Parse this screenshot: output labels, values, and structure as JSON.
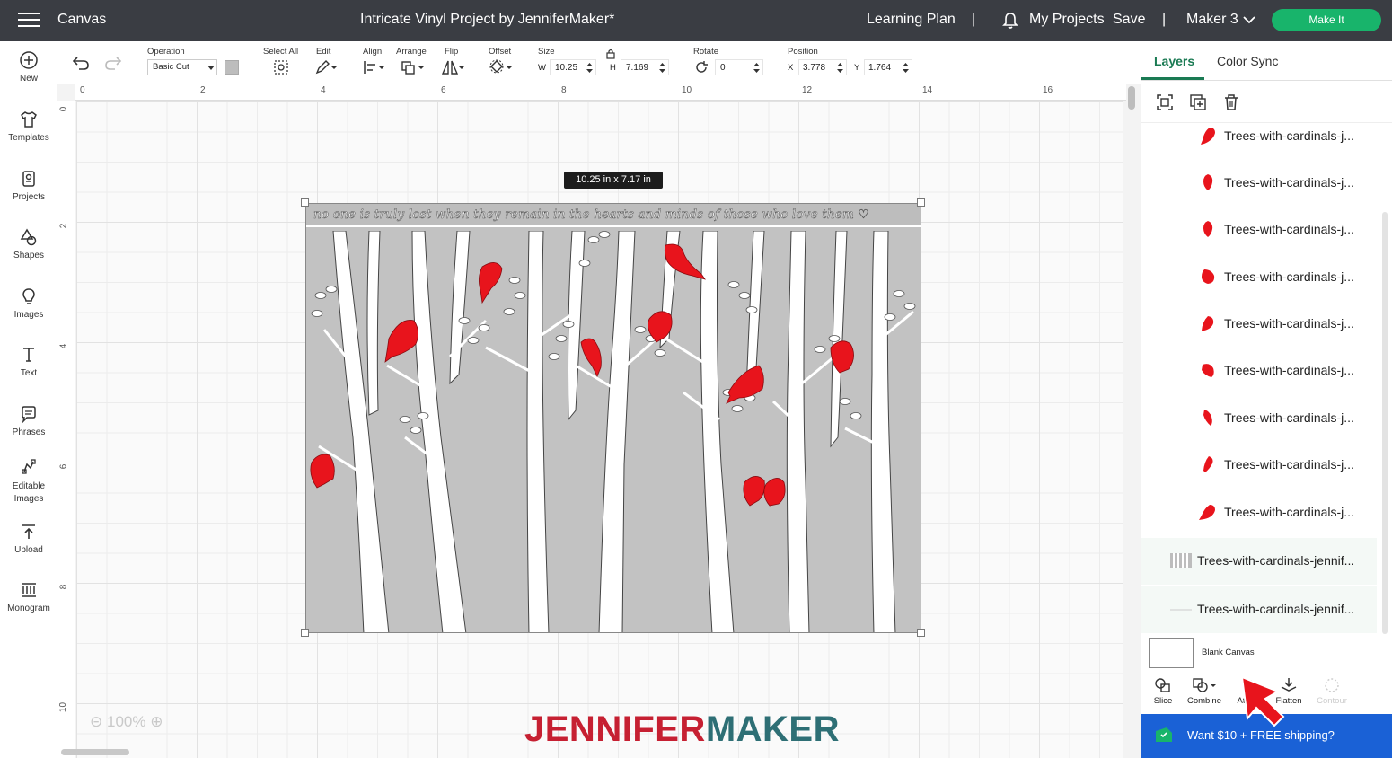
{
  "topbar": {
    "app_name": "Canvas",
    "project_title": "Intricate Vinyl Project by JenniferMaker*",
    "learning_plan": "Learning Plan",
    "my_projects": "My Projects",
    "save": "Save",
    "machine": "Maker 3",
    "make_it": "Make It",
    "separator": "|"
  },
  "leftbar": {
    "items": [
      {
        "label": "New",
        "icon": "plus-circle-icon"
      },
      {
        "label": "Templates",
        "icon": "shirt-icon"
      },
      {
        "label": "Projects",
        "icon": "projects-icon"
      },
      {
        "label": "Shapes",
        "icon": "shapes-icon"
      },
      {
        "label": "Images",
        "icon": "bulb-icon"
      },
      {
        "label": "Text",
        "icon": "text-icon"
      },
      {
        "label": "Phrases",
        "icon": "speech-bubble-icon"
      },
      {
        "label": "Editable Images",
        "icon": "editable-icon"
      },
      {
        "label": "Upload",
        "icon": "upload-icon"
      },
      {
        "label": "Monogram",
        "icon": "monogram-icon"
      }
    ]
  },
  "toolbar": {
    "operation_label": "Operation",
    "operation_value": "Basic Cut",
    "select_all": "Select All",
    "edit": "Edit",
    "align": "Align",
    "arrange": "Arrange",
    "flip": "Flip",
    "offset": "Offset",
    "size": "Size",
    "w_label": "W",
    "w_value": "10.25",
    "h_label": "H",
    "h_value": "7.169",
    "rotate": "Rotate",
    "rotate_value": "0",
    "position": "Position",
    "x_label": "X",
    "x_value": "3.778",
    "y_label": "Y",
    "y_value": "1.764"
  },
  "rulers": {
    "top": [
      "0",
      "2",
      "4",
      "6",
      "8",
      "10",
      "12",
      "14",
      "16"
    ],
    "left": [
      "0",
      "2",
      "4",
      "6",
      "8",
      "10"
    ]
  },
  "canvas": {
    "dimension_badge": "10.25  in x 7.17  in",
    "quote": "no one is truly lost when they remain in the hearts and minds of those who love them ♡",
    "zoom": "100%",
    "brand_a": "JENNIFER",
    "brand_b": "MAKER"
  },
  "layers_panel": {
    "tabs": [
      "Layers",
      "Color Sync"
    ],
    "layers": [
      "Trees-with-cardinals-j...",
      "Trees-with-cardinals-j...",
      "Trees-with-cardinals-j...",
      "Trees-with-cardinals-j...",
      "Trees-with-cardinals-j...",
      "Trees-with-cardinals-j...",
      "Trees-with-cardinals-j...",
      "Trees-with-cardinals-j...",
      "Trees-with-cardinals-j..."
    ],
    "groups": [
      "Trees-with-cardinals-jennif...",
      "Trees-with-cardinals-jennif..."
    ],
    "blank_canvas": "Blank Canvas",
    "bottom_tools": [
      "Slice",
      "Combine",
      "Attach",
      "Flatten",
      "Contour"
    ],
    "promo": "Want $10 + FREE shipping?"
  },
  "colors": {
    "topbar_bg": "#3a3d43",
    "make_it_green": "#18b46b",
    "layers_accent": "#1a7a53",
    "cardinal_red": "#e8141c",
    "brand_red": "#c62032",
    "brand_teal": "#2e6f75",
    "promo_blue": "#1a61d6"
  }
}
